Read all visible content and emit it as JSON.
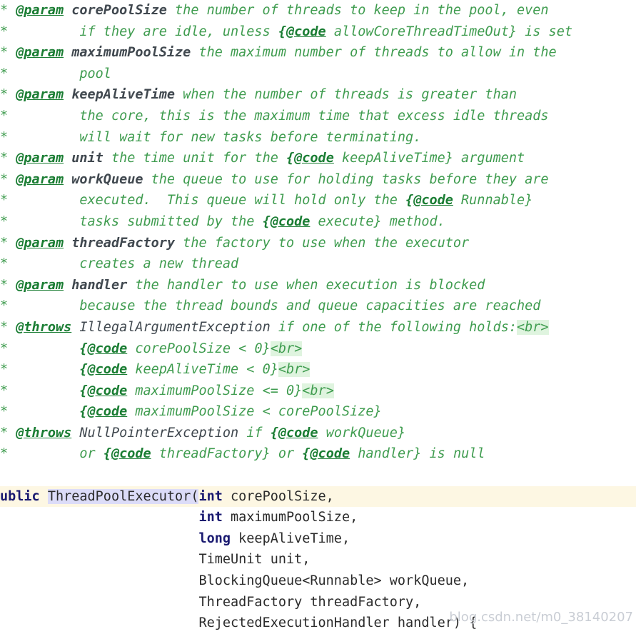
{
  "editor": {
    "language": "java",
    "colors": {
      "background": "#ffffff",
      "doc_comment": "#3f9c4f",
      "doc_tag": "#1a7d33",
      "doc_param_name": "#40484f",
      "keyword": "#191970",
      "identifier": "#2b2b2b",
      "current_line_highlight": "#fdf7e3",
      "method_name_highlight": "#dcdcf8",
      "br_tag_highlight": "#dff4df",
      "watermark": "#c9cdd4"
    }
  },
  "watermark": {
    "text": "blog.csdn.net/m0_38140207"
  },
  "doc": {
    "lines": [
      {
        "star": "*",
        "tag": "@param",
        "pname": "corePoolSize",
        "desc": " the number of threads to keep in the pool, even"
      },
      {
        "star": "*",
        "indent": "        ",
        "desc": "if they are idle, unless ",
        "code_open": "{@code",
        "code_body": " allowCoreThreadTimeOut}",
        "desc_tail": " is set"
      },
      {
        "star": "*",
        "tag": "@param",
        "pname": "maximumPoolSize",
        "desc": " the maximum number of threads to allow in the"
      },
      {
        "star": "*",
        "indent": "        ",
        "desc": "pool"
      },
      {
        "star": "*",
        "tag": "@param",
        "pname": "keepAliveTime",
        "desc": " when the number of threads is greater than"
      },
      {
        "star": "*",
        "indent": "        ",
        "desc": "the core, this is the maximum time that excess idle threads"
      },
      {
        "star": "*",
        "indent": "        ",
        "desc": "will wait for new tasks before terminating."
      },
      {
        "star": "*",
        "tag": "@param",
        "pname": "unit",
        "desc": " the time unit for the ",
        "code_open": "{@code",
        "code_body": " keepAliveTime}",
        "desc_tail": " argument"
      },
      {
        "star": "*",
        "tag": "@param",
        "pname": "workQueue",
        "desc": " the queue to use for holding tasks before they are"
      },
      {
        "star": "*",
        "indent": "        ",
        "desc": "executed.  This queue will hold only the ",
        "code_open": "{@code",
        "code_body": " Runnable}"
      },
      {
        "star": "*",
        "indent": "        ",
        "desc": "tasks submitted by the ",
        "code_open": "{@code",
        "code_body": " execute}",
        "desc_tail": " method."
      },
      {
        "star": "*",
        "tag": "@param",
        "pname": "threadFactory",
        "desc": " the factory to use when the executor"
      },
      {
        "star": "*",
        "indent": "        ",
        "desc": "creates a new thread"
      },
      {
        "star": "*",
        "tag": "@param",
        "pname": "handler",
        "desc": " the handler to use when execution is blocked"
      },
      {
        "star": "*",
        "indent": "        ",
        "desc": "because the thread bounds and queue capacities are reached"
      },
      {
        "star": "*",
        "tag": "@throws",
        "type": "IllegalArgumentException",
        "desc": " if one of the following holds:",
        "br": "<br>"
      },
      {
        "star": "*",
        "indent": "        ",
        "code_open": "{@code",
        "code_body": " corePoolSize < 0}",
        "br": "<br>"
      },
      {
        "star": "*",
        "indent": "        ",
        "code_open": "{@code",
        "code_body": " keepAliveTime < 0}",
        "br": "<br>"
      },
      {
        "star": "*",
        "indent": "        ",
        "code_open": "{@code",
        "code_body": " maximumPoolSize <= 0}",
        "br": "<br>"
      },
      {
        "star": "*",
        "indent": "        ",
        "code_open": "{@code",
        "code_body": " maximumPoolSize < corePoolSize}"
      },
      {
        "star": "*",
        "tag": "@throws",
        "type": "NullPointerException",
        "desc": " if ",
        "code_open": "{@code",
        "code_body": " workQueue}"
      },
      {
        "star": "*",
        "indent": "        ",
        "desc": "or ",
        "code_open": "{@code",
        "code_body": " threadFactory}",
        "desc_tail": " or ",
        "code_open2": "{@code",
        "code_body2": " handler}",
        "desc_tail2": " is null"
      }
    ],
    "comment_end": "*/"
  },
  "code": {
    "signature_line": {
      "modifier": "ublic",
      "method_name": "ThreadPoolExecutor",
      "open_paren": "(",
      "param_type": "int",
      "param_name": " corePoolSize,"
    },
    "param_lines": [
      {
        "indent": "                         ",
        "type": "int",
        "keyword": true,
        "name": " maximumPoolSize,"
      },
      {
        "indent": "                         ",
        "type": "long",
        "keyword": true,
        "name": " keepAliveTime,"
      },
      {
        "indent": "                         ",
        "type": "TimeUnit",
        "keyword": false,
        "name": " unit,"
      },
      {
        "indent": "                         ",
        "type": "BlockingQueue<Runnable>",
        "keyword": false,
        "name": " workQueue,"
      },
      {
        "indent": "                         ",
        "type": "ThreadFactory",
        "keyword": false,
        "name": " threadFactory,"
      },
      {
        "indent": "                         ",
        "type": "RejectedExecutionHandler",
        "keyword": false,
        "name": " handler) {"
      }
    ]
  }
}
